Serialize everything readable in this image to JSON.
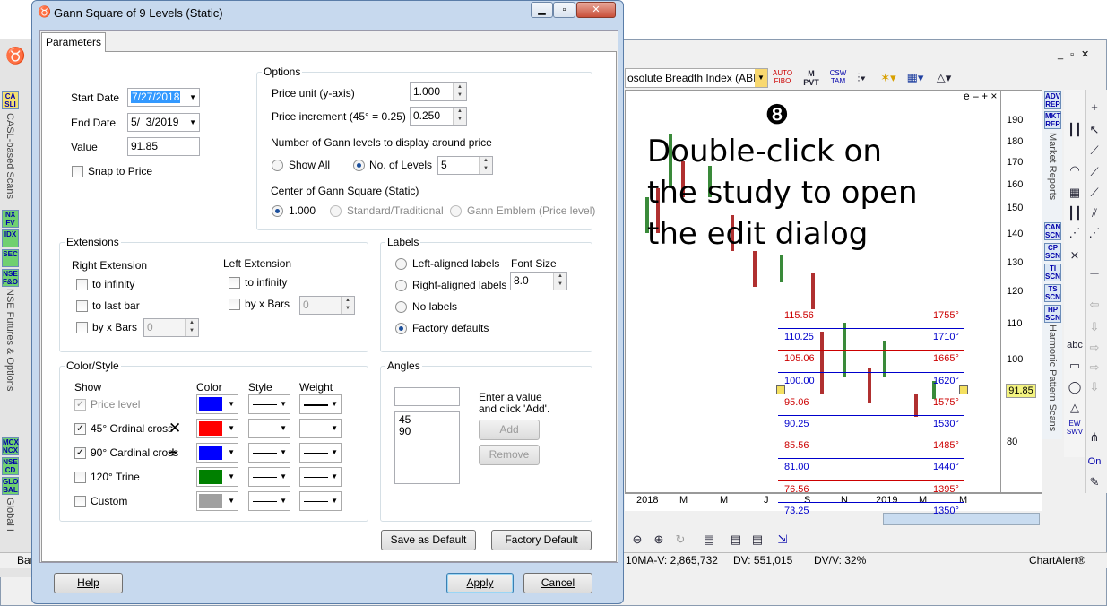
{
  "background_app": {
    "study_selector": "osolute Breadth Index (ABI",
    "chart_close_buttons": "e – + ×",
    "y_axis_ticks": [
      "190",
      "180",
      "170",
      "160",
      "150",
      "140",
      "130",
      "120",
      "110",
      "100",
      "80"
    ],
    "x_axis_ticks": [
      "2018",
      "M",
      "M",
      "J",
      "S",
      "N",
      "2019",
      "M",
      "M"
    ],
    "price_tag": "91.85",
    "gann_levels": [
      {
        "price": "115.56",
        "angle": "1755°",
        "color": "#cc0000"
      },
      {
        "price": "110.25",
        "angle": "1710°",
        "color": "#0000cc"
      },
      {
        "price": "105.06",
        "angle": "1665°",
        "color": "#cc0000"
      },
      {
        "price": "100.00",
        "angle": "1620°",
        "color": "#0000cc"
      },
      {
        "price": "95.06",
        "angle": "1575°",
        "color": "#cc0000"
      },
      {
        "price": "90.25",
        "angle": "1530°",
        "color": "#0000cc"
      },
      {
        "price": "85.56",
        "angle": "1485°",
        "color": "#cc0000"
      },
      {
        "price": "81.00",
        "angle": "1440°",
        "color": "#0000cc"
      },
      {
        "price": "76.56",
        "angle": "1395°",
        "color": "#cc0000"
      },
      {
        "price": "73.25",
        "angle": "1350°",
        "color": "#0000cc"
      }
    ],
    "left_tabs": [
      "CASL-based Scans",
      "NSE Futures & Options",
      "Global I"
    ],
    "left_buttons": [
      "CA SLI",
      "NX FV",
      "IDX",
      "SEC",
      "NSE F&O",
      "MCX NCX",
      "NSE CD",
      "GLO BAL"
    ],
    "right_panel_buttons": [
      "ADV REP",
      "MKT REP",
      "CAN SCN",
      "CP SCN",
      "TI SCN",
      "TS SCN",
      "HP SCN"
    ],
    "right_panel_labels": [
      "Market Reports",
      "Harmonic Pattern Scans"
    ],
    "toolbar_icons": [
      "AUTO FIBO",
      "M PVT",
      "CSW TAM"
    ],
    "status": {
      "ma_volume": "10MA-V: 2,865,732",
      "dv": "DV: 551,015",
      "dvv": "DV/V: 32%",
      "brand": "ChartAlert®",
      "left_bar": "Bar"
    },
    "side_tools": [
      "abc",
      "On",
      "EW SWV"
    ],
    "annotation": {
      "number": "❽",
      "lines": [
        "Double-click on",
        "the study to open",
        "the edit dialog"
      ]
    }
  },
  "dialog": {
    "title": "Gann Square of 9 Levels (Static)",
    "tab": "Parameters",
    "start_date_label": "Start Date",
    "start_date": "7/27/2018",
    "end_date_label": "End Date",
    "end_date": "5/  3/2019",
    "value_label": "Value",
    "value": "91.85",
    "snap_label": "Snap to Price",
    "options": {
      "title": "Options",
      "price_unit_label": "Price unit (y-axis)",
      "price_unit": "1.000",
      "price_inc_label": "Price increment (45° = 0.25)",
      "price_inc": "0.250",
      "levels_label": "Number of Gann levels to display around price",
      "show_all": "Show All",
      "no_levels": "No. of Levels",
      "levels_value": "5",
      "center_label": "Center of Gann Square (Static)",
      "center_opt1": "1.000",
      "center_opt2": "Standard/Traditional",
      "center_opt3": "Gann Emblem (Price level)"
    },
    "extensions": {
      "title": "Extensions",
      "right": "Right Extension",
      "left": "Left Extension",
      "to_infinity": "to infinity",
      "to_last_bar": "to last bar",
      "by_x_bars": "by x Bars",
      "bars_value": "0"
    },
    "labels": {
      "title": "Labels",
      "left_aligned": "Left-aligned labels",
      "right_aligned": "Right-aligned labels",
      "no_labels": "No labels",
      "factory": "Factory defaults",
      "font_size_label": "Font Size",
      "font_size": "8.0"
    },
    "color_style": {
      "title": "Color/Style",
      "col_show": "Show",
      "col_color": "Color",
      "col_style": "Style",
      "col_weight": "Weight",
      "rows": [
        {
          "label": "Price level",
          "checked": true,
          "disabled": true,
          "color": "#0000ff",
          "glyph": ""
        },
        {
          "label": "45° Ordinal cross",
          "checked": true,
          "disabled": false,
          "color": "#ff0000",
          "glyph": "✕"
        },
        {
          "label": "90° Cardinal cross",
          "checked": true,
          "disabled": false,
          "color": "#0000ff",
          "glyph": "+"
        },
        {
          "label": "120° Trine",
          "checked": false,
          "disabled": false,
          "color": "#008000",
          "glyph": ""
        },
        {
          "label": "Custom",
          "checked": false,
          "disabled": false,
          "color": "#a0a0a0",
          "glyph": ""
        }
      ]
    },
    "angles": {
      "title": "Angles",
      "hint": "Enter a value and click 'Add'.",
      "list": [
        "45",
        "90"
      ],
      "add": "Add",
      "remove": "Remove"
    },
    "save_default": "Save as Default",
    "factory_default": "Factory Default",
    "help": "Help",
    "apply": "Apply",
    "cancel": "Cancel"
  }
}
